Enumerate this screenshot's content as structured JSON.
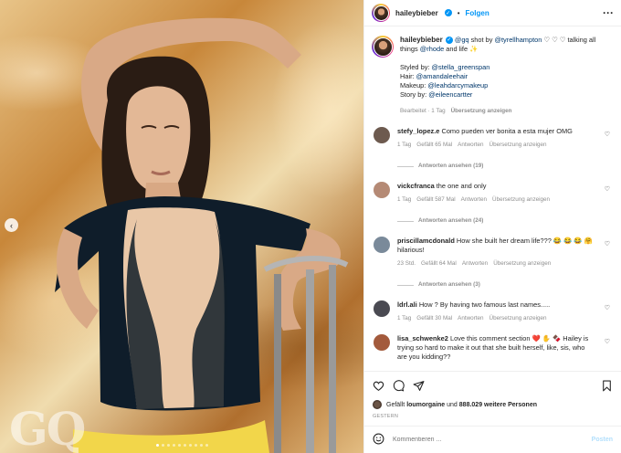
{
  "author": {
    "username": "haileybieber",
    "follow_label": "Folgen"
  },
  "caption": {
    "username": "haileybieber",
    "text_parts": [
      "@gq",
      " shot by ",
      "@tyrellhampton",
      " ♡ ♡ ♡ talking all things ",
      "@rhode",
      " and life ✨"
    ],
    "lines": [
      {
        "label": "Styled by: ",
        "handle": "@stella_greenspan"
      },
      {
        "label": "Hair: ",
        "handle": "@amandaleehair"
      },
      {
        "label": "Makeup: ",
        "handle": "@leahdarcymakeup"
      },
      {
        "label": "Story by: ",
        "handle": "@eileencartter"
      }
    ],
    "edited": "Bearbeitet · 1 Tag",
    "translate": "Übersetzung anzeigen"
  },
  "comments": [
    {
      "user": "stefy_lopez.e",
      "text": "Como pueden ver bonita a esta mujer OMG",
      "time": "1 Tag",
      "likes": "Gefällt 65 Mal",
      "reply": "Antworten",
      "translate": "Übersetzung anzeigen",
      "replies": "Antworten ansehen (19)",
      "avatar_color": "#6d5a4f"
    },
    {
      "user": "vickcfranca",
      "text": "the one and only",
      "time": "1 Tag",
      "likes": "Gefällt 587 Mal",
      "reply": "Antworten",
      "translate": "Übersetzung anzeigen",
      "replies": "Antworten ansehen (24)",
      "avatar_color": "#b58a75"
    },
    {
      "user": "priscillamcdonald",
      "text": "How she built her dream life??? 😂 😂 😂 🤗 hilarious!",
      "time": "23 Std.",
      "likes": "Gefällt 64 Mal",
      "reply": "Antworten",
      "translate": "Übersetzung anzeigen",
      "replies": "Antworten ansehen (3)",
      "avatar_color": "#7a8a9a"
    },
    {
      "user": "ldrl.ali",
      "text": "How ? By having two famous last names.....",
      "time": "1 Tag",
      "likes": "Gefällt 30 Mal",
      "reply": "Antworten",
      "translate": "Übersetzung anzeigen",
      "replies": "",
      "avatar_color": "#4a4a52"
    },
    {
      "user": "lisa_schwenke2",
      "text": "Love this comment section ❤️ ✋ 🍫 Hailey is trying so hard to make it out that she built herself, like, sis, who are you kidding??",
      "time": "",
      "likes": "",
      "reply": "",
      "translate": "",
      "replies": "",
      "avatar_color": "#a35a3c"
    }
  ],
  "likes": {
    "prefix": "Gefällt ",
    "user": "loumorgaine",
    "middle": " und ",
    "count": "888.029 weitere Personen"
  },
  "date": "GESTERN",
  "composer": {
    "placeholder": "Kommentieren ...",
    "post_label": "Posten"
  },
  "media": {
    "watermark": "GQ",
    "slide_count": 10,
    "active_slide": 0
  }
}
